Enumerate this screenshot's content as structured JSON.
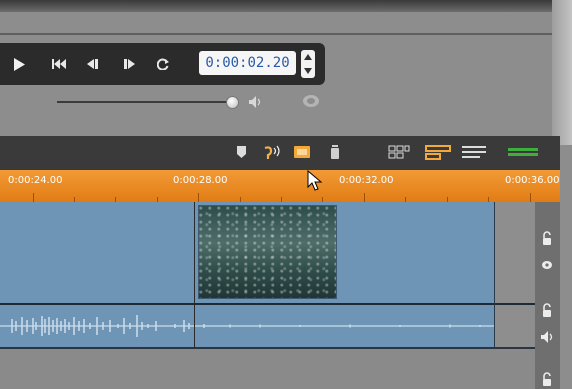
{
  "transport": {
    "timecode": "0:00:02.20",
    "buttons": [
      "play",
      "go-to-start",
      "rewind",
      "fast-forward",
      "loop"
    ]
  },
  "volume": {
    "level": 0.97
  },
  "timeline": {
    "ruler_labels": [
      "0:00:24.00",
      "0:00:28.00",
      "0:00:32.00",
      "0:00:36.00"
    ],
    "toolbar_icons": [
      "marker-icon",
      "scrub-audio-icon",
      "storyboard-icon",
      "trash-icon",
      "view-storyboard-icon",
      "view-timeline-icon",
      "view-text-icon",
      "audio-meter-icon"
    ]
  },
  "colors": {
    "ruler": "#e88a20",
    "track": "#6e94b6",
    "timecode_text": "#2a5aa8"
  }
}
